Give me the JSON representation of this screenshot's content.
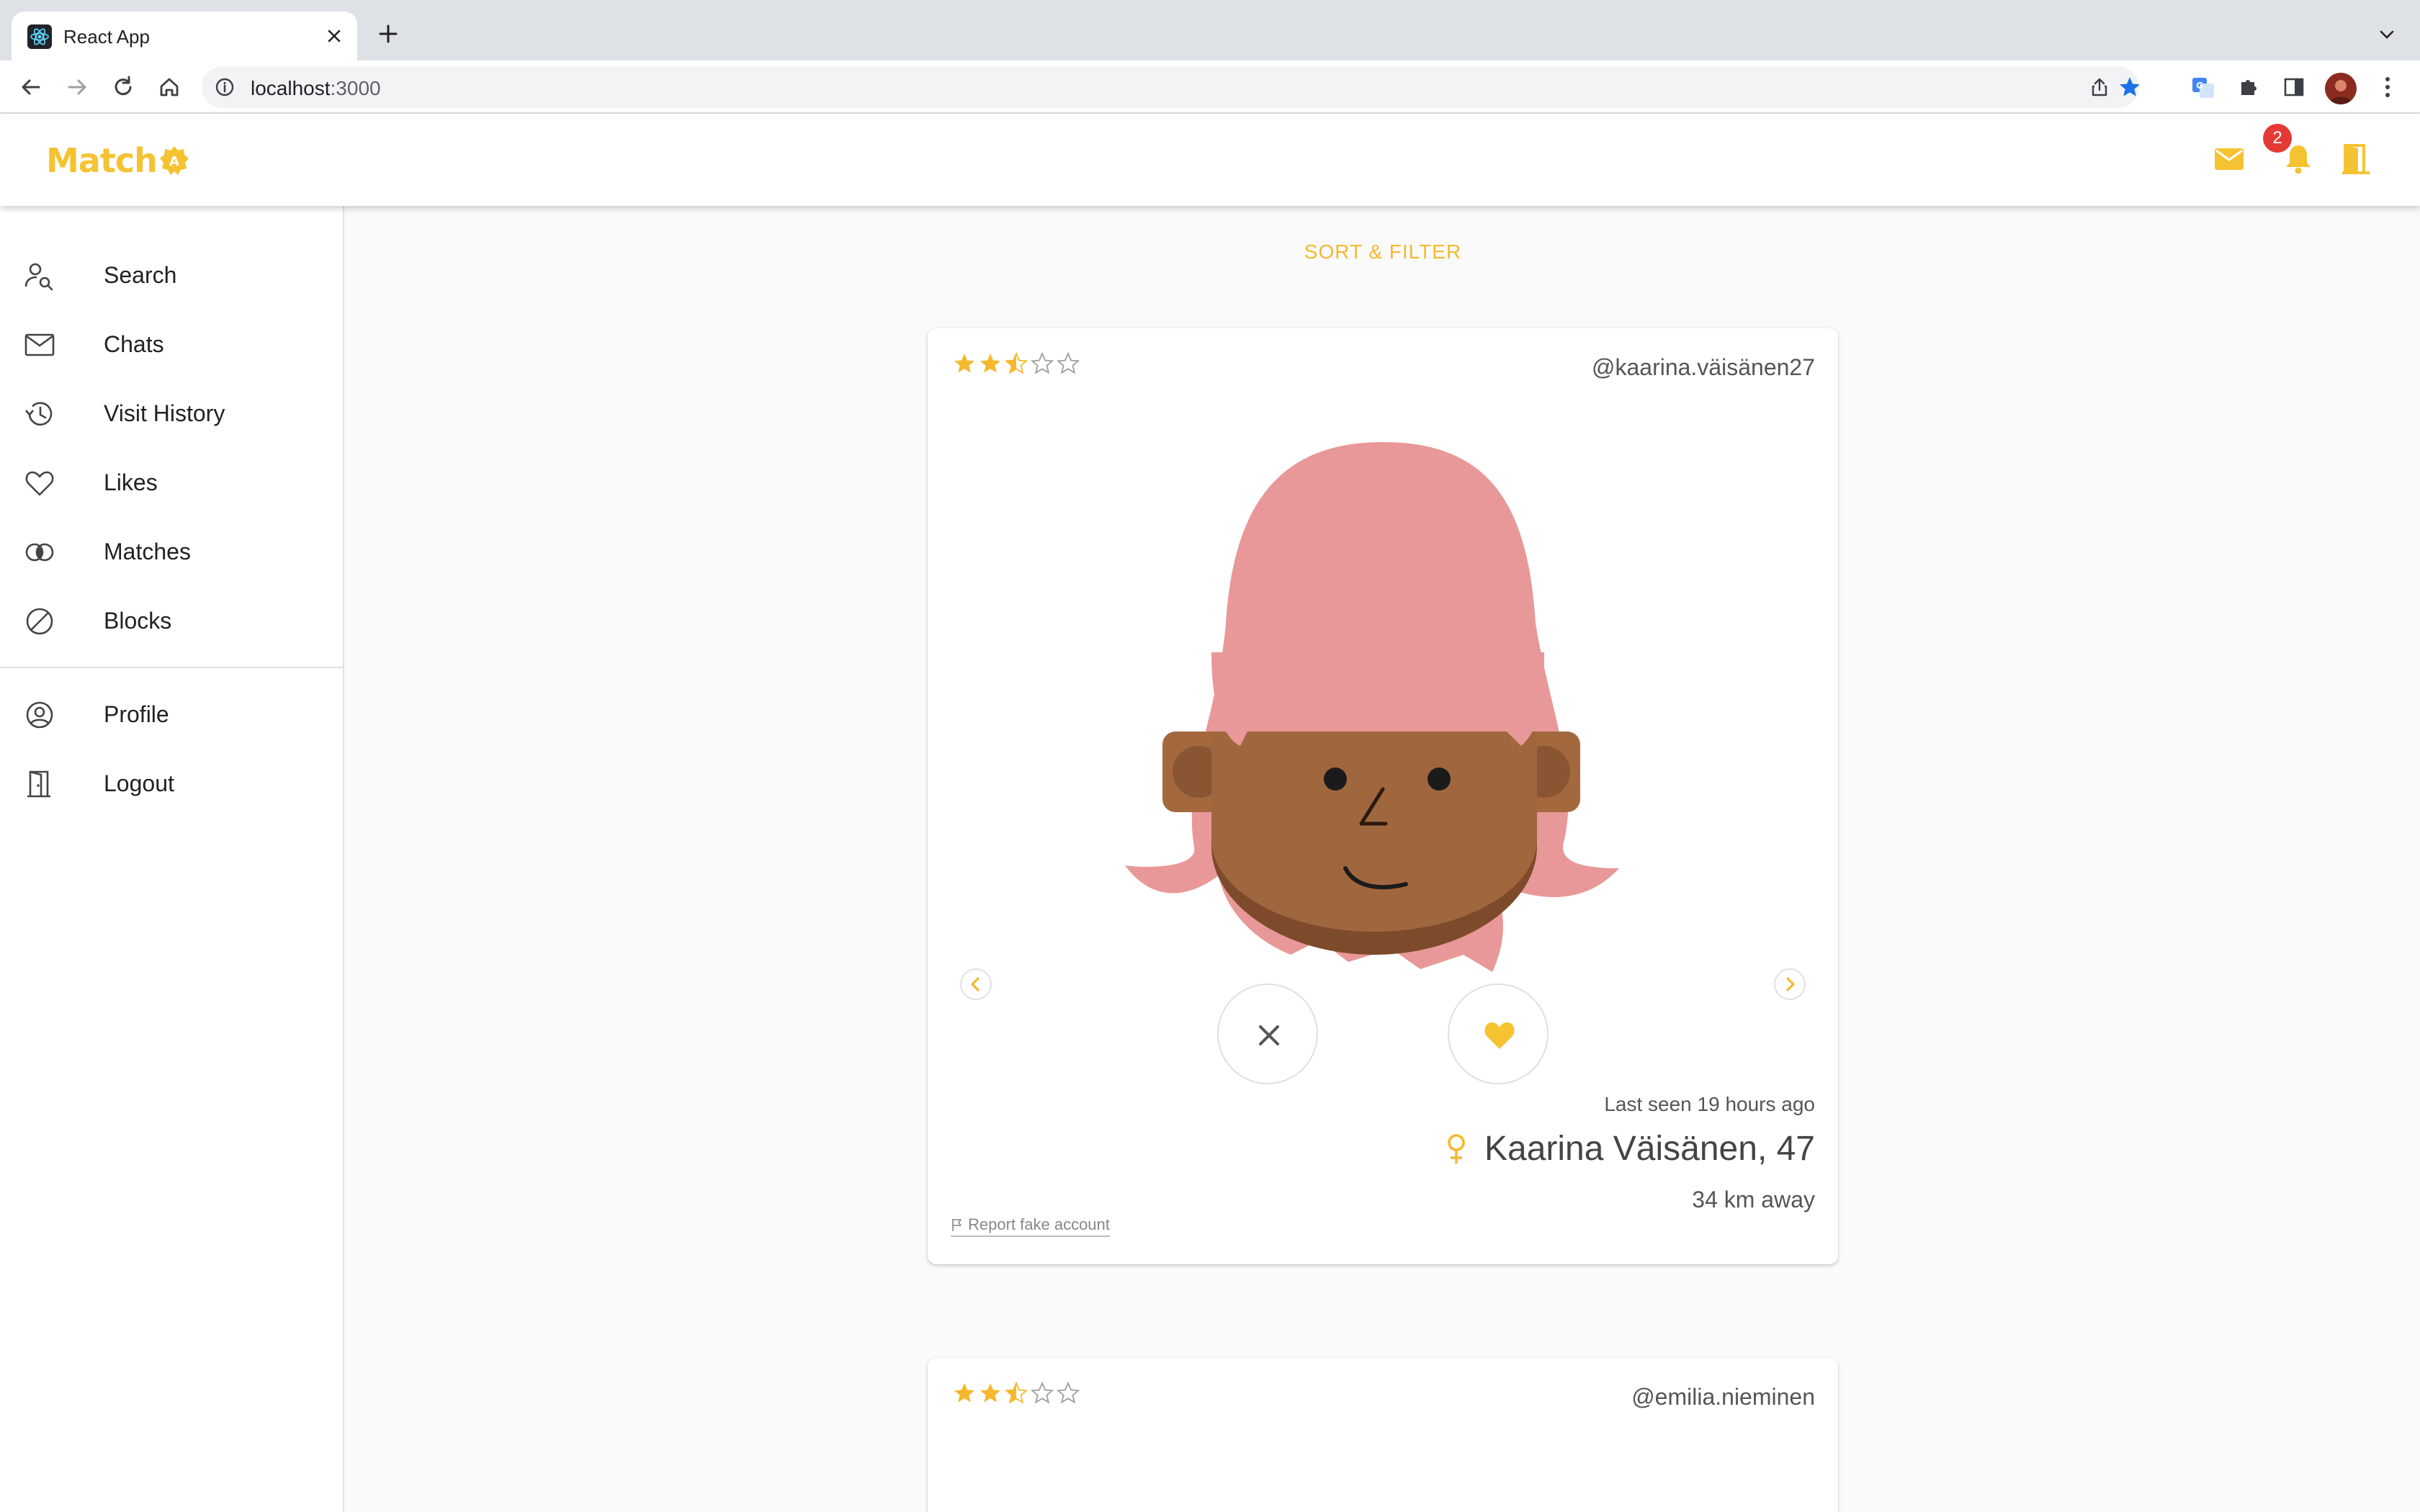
{
  "browser": {
    "tab_title": "React App",
    "url_host": "localhost",
    "url_port": ":3000"
  },
  "app": {
    "logo_text": "Match",
    "logo_badge_letter": "A",
    "accent_color": "#f5c332",
    "notifications_count": "2"
  },
  "sidebar": {
    "items": [
      {
        "label": "Search",
        "icon": "person-search-icon"
      },
      {
        "label": "Chats",
        "icon": "mail-icon"
      },
      {
        "label": "Visit History",
        "icon": "history-icon"
      },
      {
        "label": "Likes",
        "icon": "heart-icon"
      },
      {
        "label": "Matches",
        "icon": "matches-icon"
      },
      {
        "label": "Blocks",
        "icon": "block-icon"
      }
    ],
    "secondary_items": [
      {
        "label": "Profile",
        "icon": "account-circle-icon"
      },
      {
        "label": "Logout",
        "icon": "door-icon"
      }
    ]
  },
  "main": {
    "sort_filter_label": "SORT & FILTER",
    "profiles": [
      {
        "username": "@kaarina.väisänen27",
        "rating": 2.5,
        "rating_max": 5,
        "last_seen": "Last seen 19 hours ago",
        "name_age": "Kaarina Väisänen, 47",
        "gender_icon": "female-icon",
        "distance": "34 km away",
        "report_label": "Report fake account"
      },
      {
        "username": "@emilia.nieminen",
        "rating": 2.5,
        "rating_max": 5
      }
    ]
  }
}
